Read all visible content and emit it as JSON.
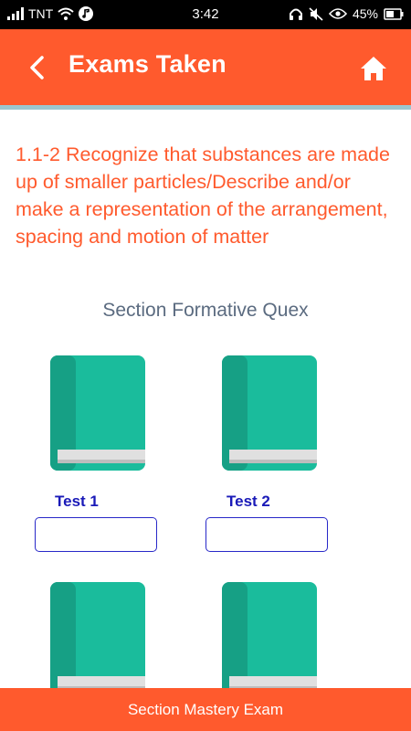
{
  "status_bar": {
    "carrier": "TNT",
    "time": "3:42",
    "battery": "45%",
    "icons": [
      "signal-icon",
      "wifi-icon",
      "music-icon",
      "headset-icon",
      "mute-icon",
      "eye-icon",
      "battery-icon"
    ]
  },
  "header": {
    "title": "Exams Taken",
    "back_icon": "chevron-left-icon",
    "home_icon": "home-icon",
    "color": "#ff5a2d"
  },
  "topic": "1.1-2 Recognize that substances are made up of smaller particles/Describe and/or make a representation of the arrangement, spacing and motion of matter",
  "section": {
    "title": "Section Formative Quex",
    "tests": [
      {
        "label": "Test 1",
        "icon": "book-icon",
        "score": ""
      },
      {
        "label": "Test 2",
        "icon": "book-icon",
        "score": ""
      },
      {
        "label": "",
        "icon": "book-icon",
        "score": ""
      },
      {
        "label": "",
        "icon": "book-icon",
        "score": ""
      }
    ]
  },
  "bottom_bar": {
    "label": "Section Mastery Exam"
  },
  "colors": {
    "accent": "#ff5a2d",
    "book_cover": "#1abc9c",
    "book_spine": "#16a085",
    "test_label": "#1a1ab8",
    "section_title": "#5b6b80"
  }
}
